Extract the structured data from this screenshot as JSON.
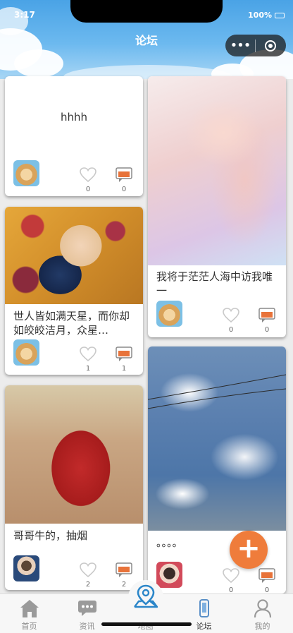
{
  "status": {
    "time": "3:17",
    "battery": "100%"
  },
  "header": {
    "title": "论坛"
  },
  "posts": [
    {
      "text": "hhhh",
      "likes": "0",
      "comments": "0"
    },
    {
      "text": "世人皆如满天星，而你却如皎皎洁月，众星…",
      "likes": "1",
      "comments": "1"
    },
    {
      "text": "哥哥牛的，抽烟",
      "likes": "2",
      "comments": "2"
    },
    {
      "text": "我将于茫茫人海中访我唯一",
      "likes": "0",
      "comments": "0"
    },
    {
      "text": "。。。。",
      "likes": "0",
      "comments": "0"
    }
  ],
  "fab": {
    "label": "+"
  },
  "tabs": [
    {
      "label": "首页",
      "icon": "home-icon"
    },
    {
      "label": "资讯",
      "icon": "news-icon"
    },
    {
      "label": "地图",
      "icon": "map-icon"
    },
    {
      "label": "论坛",
      "icon": "forum-icon"
    },
    {
      "label": "我的",
      "icon": "profile-icon"
    }
  ],
  "colors": {
    "accent": "#ef7c3b",
    "map_icon": "#2b86c9",
    "header_sky": "#4aa3e6"
  }
}
